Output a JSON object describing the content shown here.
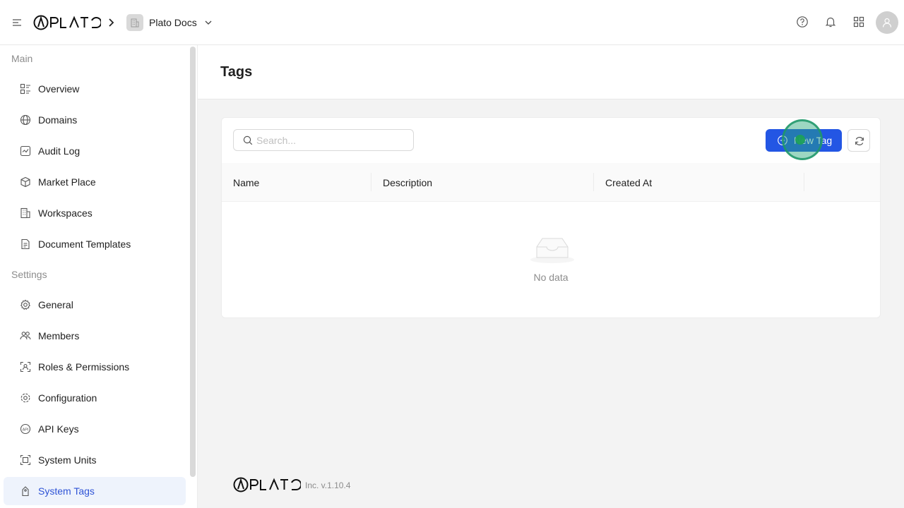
{
  "header": {
    "brand": "PLATO",
    "workspace": "Plato Docs",
    "icons": [
      "help-icon",
      "bell-icon",
      "apps-grid-icon",
      "user-avatar-icon"
    ]
  },
  "sidebar": {
    "sections": [
      {
        "title": "Main",
        "items": [
          {
            "label": "Overview",
            "icon": "overview-icon"
          },
          {
            "label": "Domains",
            "icon": "globe-icon"
          },
          {
            "label": "Audit Log",
            "icon": "audit-log-icon"
          },
          {
            "label": "Market Place",
            "icon": "cube-icon"
          },
          {
            "label": "Workspaces",
            "icon": "building-icon"
          },
          {
            "label": "Document Templates",
            "icon": "document-icon"
          }
        ]
      },
      {
        "title": "Settings",
        "items": [
          {
            "label": "General",
            "icon": "gear-icon"
          },
          {
            "label": "Members",
            "icon": "members-icon"
          },
          {
            "label": "Roles & Permissions",
            "icon": "roles-icon"
          },
          {
            "label": "Configuration",
            "icon": "config-icon"
          },
          {
            "label": "API Keys",
            "icon": "api-icon"
          },
          {
            "label": "System Units",
            "icon": "units-icon"
          },
          {
            "label": "System Tags",
            "icon": "tag-icon",
            "active": true
          }
        ]
      }
    ]
  },
  "page": {
    "title": "Tags",
    "search": {
      "placeholder": "Search...",
      "value": ""
    },
    "new_button": "New Tag",
    "table": {
      "columns": [
        "Name",
        "Description",
        "Created At",
        ""
      ],
      "rows": [],
      "empty_text": "No data"
    }
  },
  "footer": {
    "brand": "PLATO",
    "version": "Inc. v.1.10.4"
  },
  "colors": {
    "primary": "#2356e4",
    "active_bg": "#eef3fc",
    "active_text": "#2f54d6",
    "click_marker": "#1e9669"
  }
}
